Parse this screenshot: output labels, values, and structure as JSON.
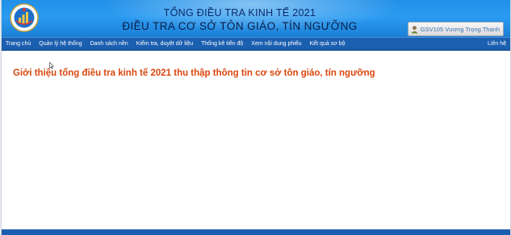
{
  "header": {
    "title_line1": "TỔNG ĐIỀU TRA KINH TẾ 2021",
    "title_line2": "ĐIỀU TRA CƠ SỞ TÔN GIÁO, TÍN NGƯỠNG",
    "logo_icon": "statistics-emblem-icon",
    "user_label": "GSV105 Vương Trọng Thanh",
    "user_icon": "user-icon"
  },
  "nav": {
    "items": [
      "Trang chủ",
      "Quản lý hệ thống",
      "Danh sách nền",
      "Kiểm tra, duyệt dữ liệu",
      "Thống kê tiến độ",
      "Xem nội dung phiếu",
      "Kết quả sơ bộ"
    ],
    "contact": "Liên hệ"
  },
  "main": {
    "heading": "Giới thiệu tổng điều tra kinh tế 2021 thu thập thông tin cơ sở tôn giáo, tín ngưỡng"
  },
  "colors": {
    "banner": "#1f8fe8",
    "nav": "#1b5fb0",
    "heading": "#d9470f"
  }
}
